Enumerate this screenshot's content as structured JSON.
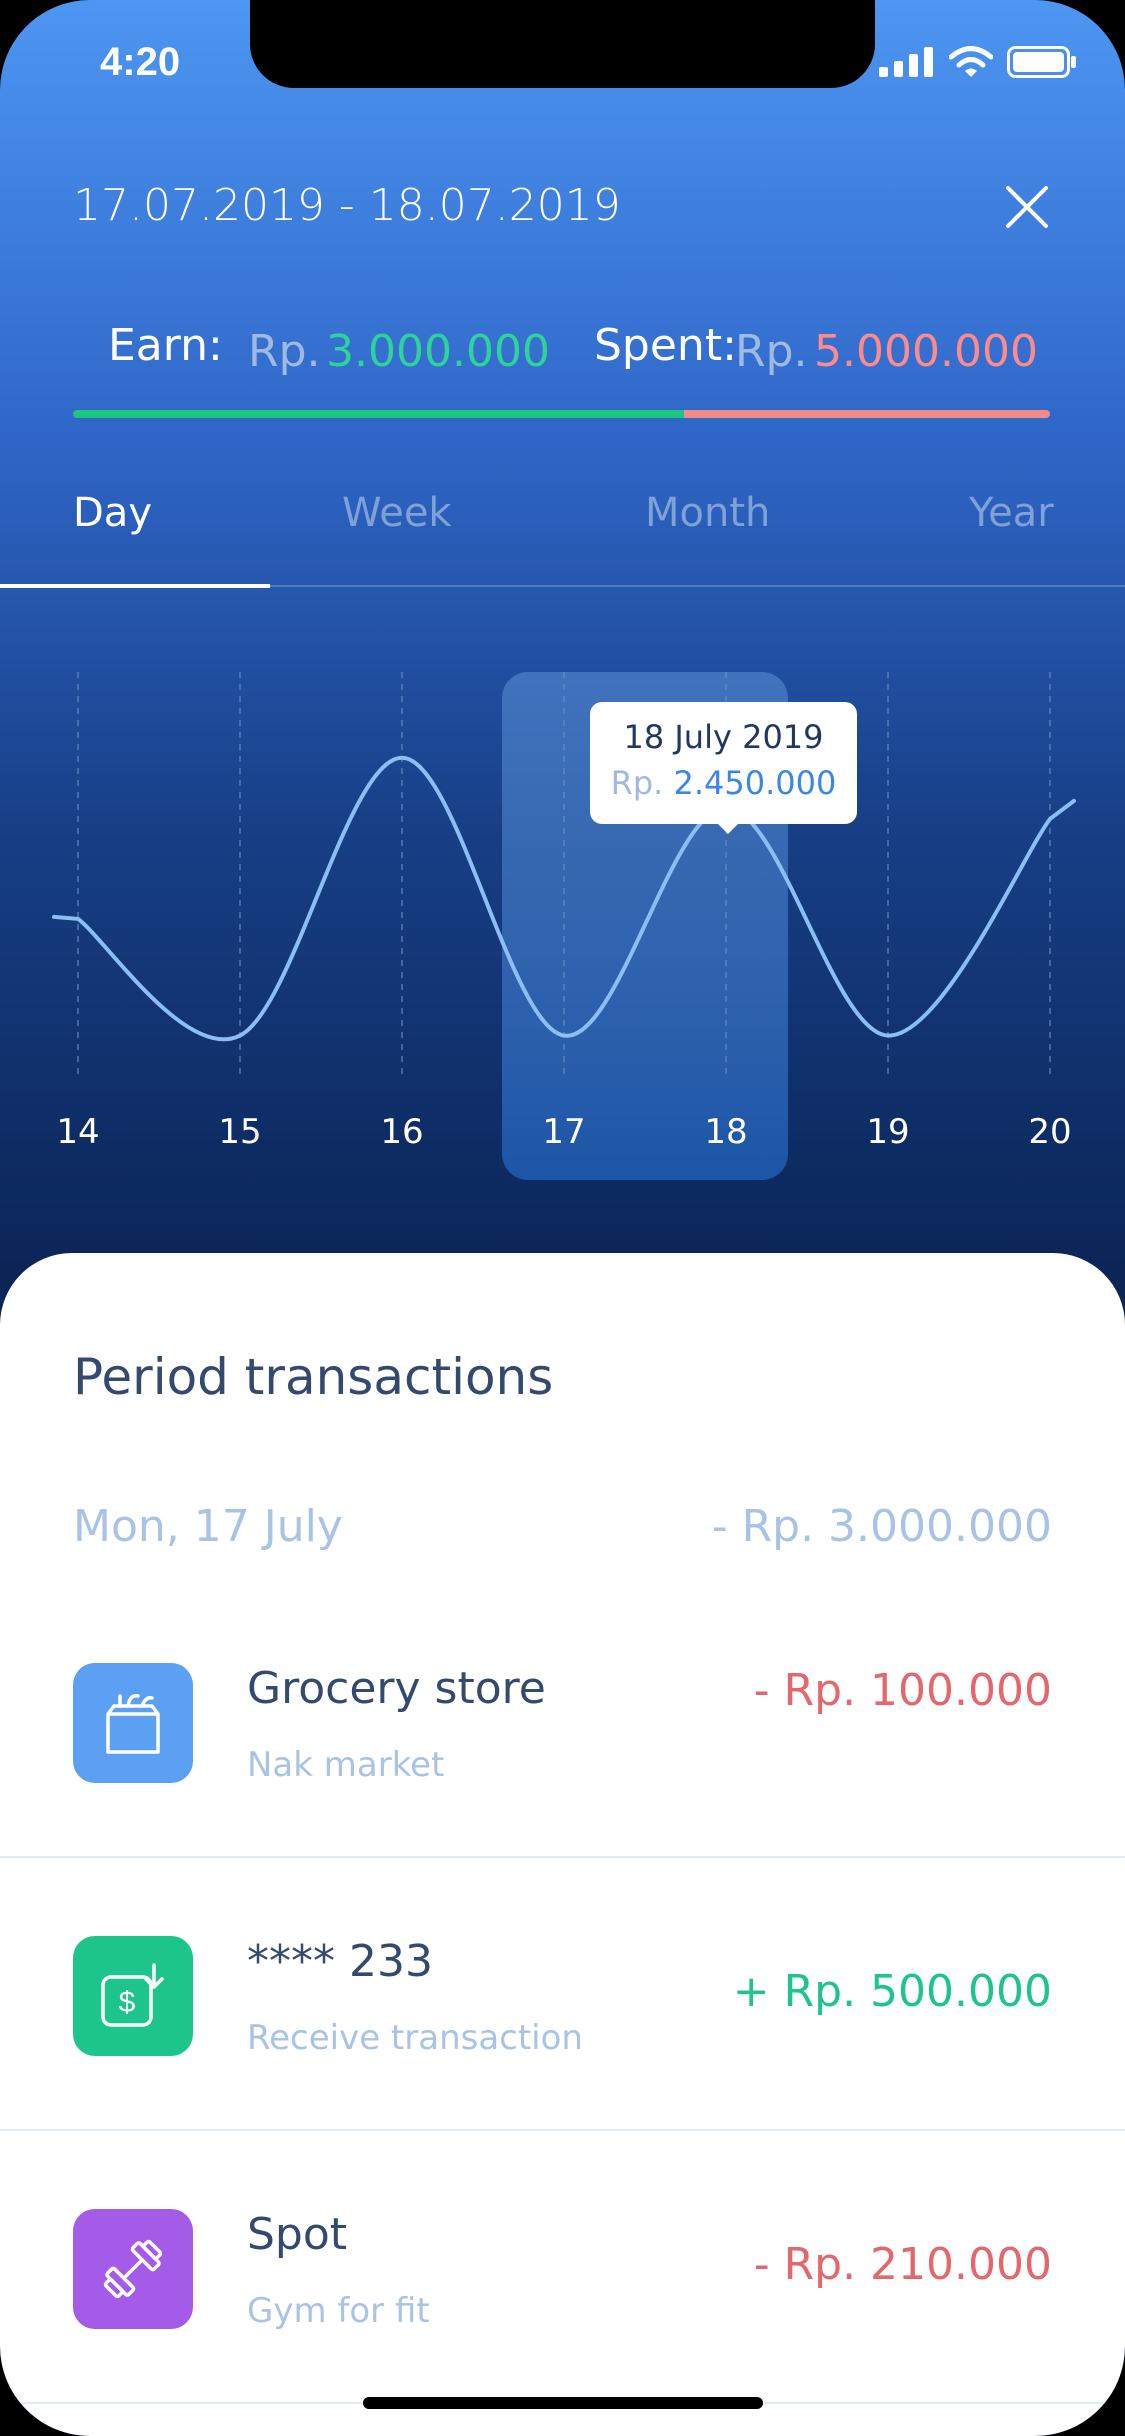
{
  "status_bar": {
    "time": "4:20"
  },
  "header": {
    "date_range": "17.07.2019 - 18.07.2019"
  },
  "summary": {
    "earn_label": "Earn:",
    "spent_label": "Spent:",
    "currency": "Rp.",
    "earn_value": "3.000.000",
    "spent_value": "5.000.000",
    "earn_color": "#1dc57d",
    "spent_color": "#f48a8a",
    "earn_fraction": 0.625
  },
  "tabs": [
    {
      "label": "Day",
      "active": true
    },
    {
      "label": "Week",
      "active": false
    },
    {
      "label": "Month",
      "active": false
    },
    {
      "label": "Year",
      "active": false
    }
  ],
  "chart_data": {
    "type": "line",
    "x": [
      "14",
      "15",
      "16",
      "17",
      "18",
      "19",
      "20"
    ],
    "series": [
      {
        "values": [
          1.45,
          0.4,
          2.9,
          0.4,
          2.45,
          0.4,
          2.35
        ]
      }
    ],
    "selected_index": 4,
    "tooltip": {
      "date": "18 July 2019",
      "currency": "Rp.",
      "value": "2.450.000"
    },
    "ylim": [
      0,
      3.6
    ],
    "grid": "vertical-dashed",
    "line_color": "#8cbdf5"
  },
  "transactions": {
    "title": "Period transactions",
    "day_label": "Mon, 17 July",
    "day_total": "- Rp. 3.000.000",
    "items": [
      {
        "name": "Grocery store",
        "sub": "Nak market",
        "amount": "- Rp. 100.000",
        "icon": "grocery-bag-icon",
        "icon_color": "#5ba0f2",
        "amount_color": "#e4676b"
      },
      {
        "name": "**** 233",
        "sub": "Receive transaction",
        "amount": "+ Rp. 500.000",
        "icon": "receive-money-icon",
        "icon_color": "#1dc58a",
        "amount_color": "#1dc58a"
      },
      {
        "name": "Spot",
        "sub": "Gym for fit",
        "amount": "- Rp. 210.000",
        "icon": "dumbbell-icon",
        "icon_color": "#a35be8",
        "amount_color": "#e4676b"
      }
    ]
  }
}
